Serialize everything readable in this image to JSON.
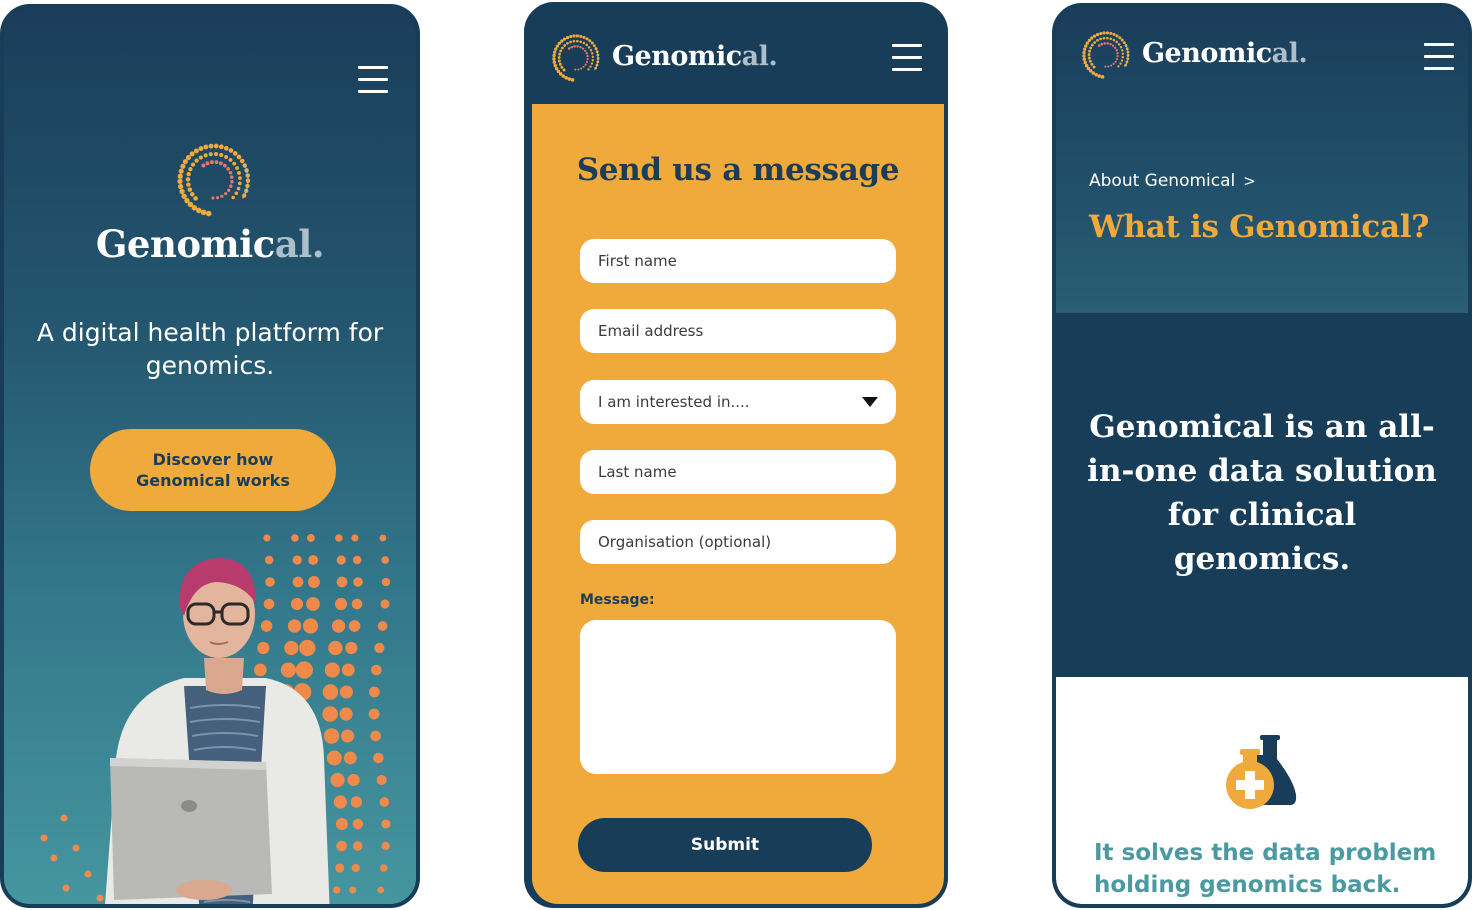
{
  "colors": {
    "navy": "#183d59",
    "orange": "#f0a93b",
    "teal": "#4a9aa0",
    "white": "#ffffff",
    "brand_accent": "#aebfcc"
  },
  "brand": {
    "name_main": "Genomic",
    "name_accent": "al."
  },
  "screen_home": {
    "menu_icon": "hamburger-icon",
    "logo_icon": "dotted-spiral-logo-icon",
    "tagline": "A digital health platform for genomics.",
    "cta_label": "Discover how Genomical works",
    "hero_image": "woman-with-laptop-photo"
  },
  "screen_contact": {
    "menu_icon": "hamburger-icon",
    "title": "Send us a message",
    "fields": [
      {
        "name": "first-name-field",
        "placeholder": "First name",
        "type": "text"
      },
      {
        "name": "email-field",
        "placeholder": "Email address",
        "type": "text"
      },
      {
        "name": "interest-select",
        "placeholder": "I am interested in....",
        "type": "select"
      },
      {
        "name": "last-name-field",
        "placeholder": "Last name",
        "type": "text"
      },
      {
        "name": "organisation-field",
        "placeholder": "Organisation (optional)",
        "type": "text"
      }
    ],
    "message_label": "Message:",
    "message_value": "",
    "submit_label": "Submit"
  },
  "screen_about": {
    "menu_icon": "hamburger-icon",
    "breadcrumb": "About Genomical",
    "breadcrumb_sep": ">",
    "title": "What is Genomical?",
    "statement": "Genomical is an all-in-one data solution for clinical genomics.",
    "feature_icon": "medicine-flask-icon",
    "feature_text": "It solves the data problem holding genomics back."
  }
}
